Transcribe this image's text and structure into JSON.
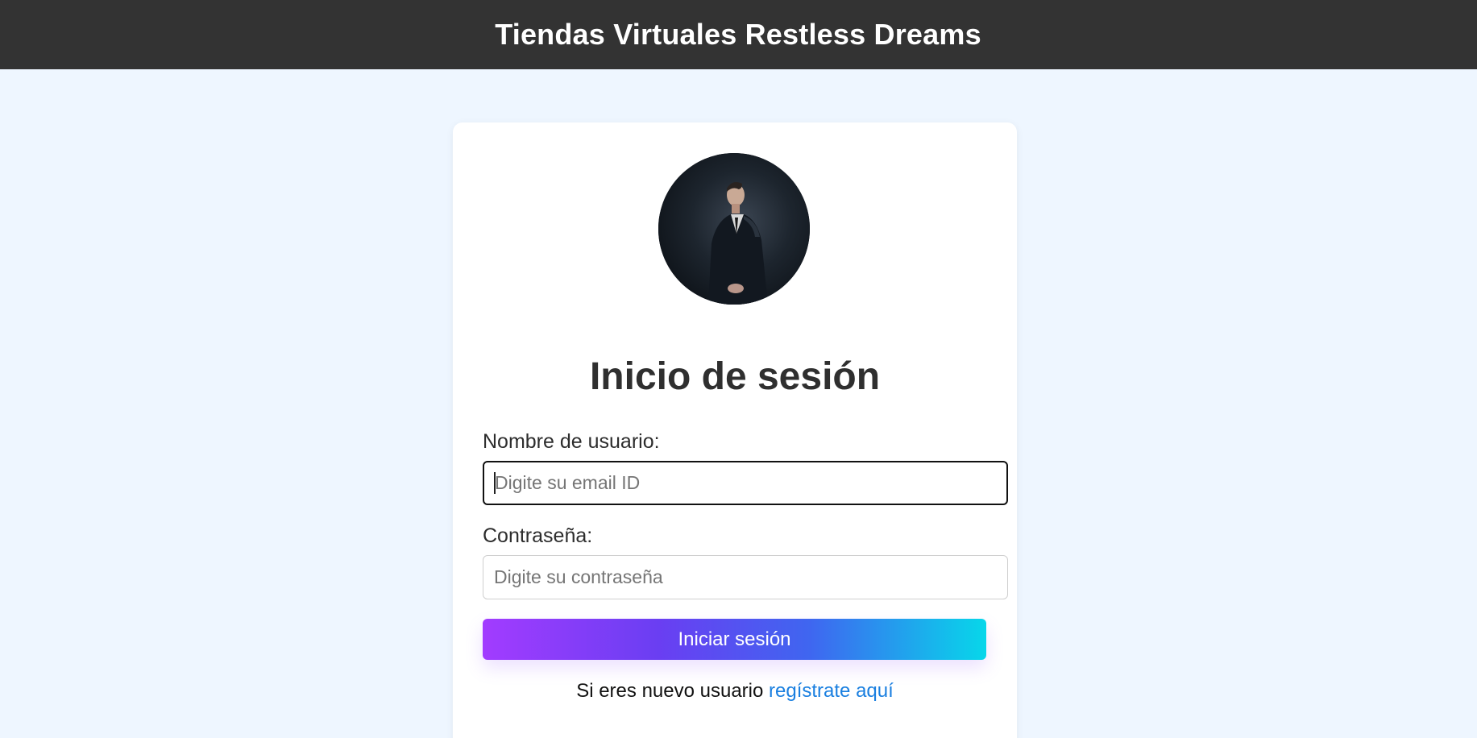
{
  "header": {
    "title": "Tiendas Virtuales Restless Dreams"
  },
  "login": {
    "heading": "Inicio de sesión",
    "username_label": "Nombre de usuario:",
    "username_placeholder": "Digite su email ID",
    "username_value": "",
    "password_label": "Contraseña:",
    "password_placeholder": "Digite su contraseña",
    "password_value": "",
    "submit_label": "Iniciar sesión",
    "register_prompt": "Si eres nuevo usuario",
    "register_link": "regístrate aquí"
  },
  "colors": {
    "header_bg": "#333333",
    "page_bg": "#eef6ff",
    "link": "#1a7fe0",
    "button_gradient_start": "#a23cff",
    "button_gradient_end": "#07d7ea"
  }
}
